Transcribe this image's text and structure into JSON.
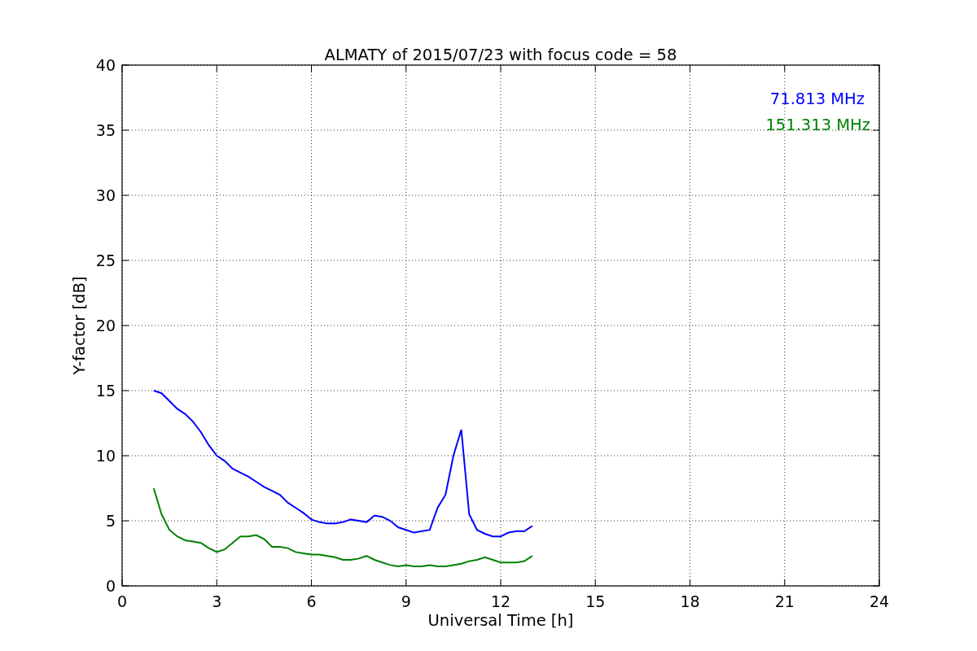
{
  "chart_data": {
    "type": "line",
    "title": "ALMATY of 2015/07/23 with focus code = 58",
    "xlabel": "Universal Time [h]",
    "ylabel": "Y-factor [dB]",
    "x": [
      1,
      1.25,
      1.5,
      1.75,
      2,
      2.25,
      2.5,
      2.75,
      3,
      3.25,
      3.5,
      3.75,
      4,
      4.25,
      4.5,
      4.75,
      5,
      5.25,
      5.5,
      5.75,
      6,
      6.25,
      6.5,
      6.75,
      7,
      7.25,
      7.5,
      7.75,
      8,
      8.25,
      8.5,
      8.75,
      9,
      9.25,
      9.5,
      9.75,
      10,
      10.25,
      10.5,
      10.75,
      11,
      11.25,
      11.5,
      11.75,
      12,
      12.25,
      12.5,
      12.75,
      13
    ],
    "series": [
      {
        "name": "71.813 MHz",
        "color": "#0000ff",
        "values": [
          15,
          14.8,
          14.2,
          13.6,
          13.2,
          12.6,
          11.8,
          10.8,
          10,
          9.6,
          9,
          8.7,
          8.4,
          8,
          7.6,
          7.3,
          7,
          6.4,
          6,
          5.6,
          5.1,
          4.9,
          4.8,
          4.8,
          4.9,
          5.1,
          5,
          4.9,
          5.4,
          5.3,
          5,
          4.5,
          4.3,
          4.1,
          4.2,
          4.3,
          6,
          7,
          10,
          12,
          5.5,
          4.3,
          4,
          3.8,
          3.8,
          4.1,
          4.2,
          4.2,
          4.6
        ]
      },
      {
        "name": "151.313 MHz",
        "color": "#008000",
        "values": [
          7.5,
          5.5,
          4.3,
          3.8,
          3.5,
          3.4,
          3.3,
          2.9,
          2.6,
          2.8,
          3.3,
          3.8,
          3.8,
          3.9,
          3.6,
          3,
          3,
          2.9,
          2.6,
          2.5,
          2.4,
          2.4,
          2.3,
          2.2,
          2,
          2,
          2.1,
          2.3,
          2,
          1.8,
          1.6,
          1.5,
          1.6,
          1.5,
          1.5,
          1.6,
          1.5,
          1.5,
          1.6,
          1.7,
          1.9,
          2,
          2.2,
          2,
          1.8,
          1.8,
          1.8,
          1.9,
          2.3
        ]
      }
    ],
    "xlim": [
      0,
      24
    ],
    "ylim": [
      0,
      40
    ],
    "xticks": [
      0,
      3,
      6,
      9,
      12,
      15,
      18,
      21,
      24
    ],
    "yticks": [
      0,
      5,
      10,
      15,
      20,
      25,
      30,
      35,
      40
    ],
    "grid": true
  }
}
